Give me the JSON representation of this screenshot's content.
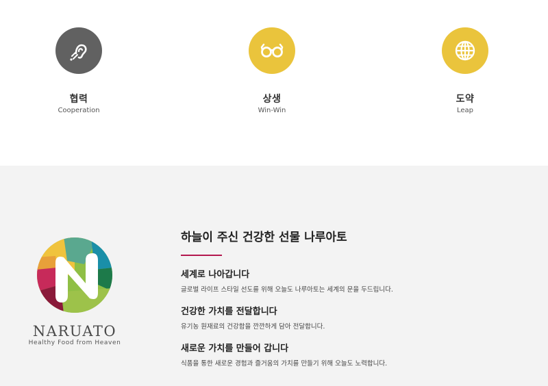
{
  "values": [
    {
      "ko": "협력",
      "en": "Cooperation",
      "icon": "hearing-icon",
      "color": "#616161"
    },
    {
      "ko": "상생",
      "en": "Win-Win",
      "icon": "glasses-icon",
      "color": "#eac43c"
    },
    {
      "ko": "도약",
      "en": "Leap",
      "icon": "globe-icon",
      "color": "#eac43c"
    }
  ],
  "about": {
    "title": "하늘이 주신 건강한 선물 나루아토",
    "accent": "#b3164d",
    "items": [
      {
        "heading": "세계로 나아갑니다",
        "desc": "글로벌 라이프 스타일 선도를 위해 오늘도 나루아토는 세계의 문을 두드립니다."
      },
      {
        "heading": "건강한 가치를 전달합니다",
        "desc": "유기농 원재료의 건강함을 깐깐하게 담아 전달합니다."
      },
      {
        "heading": "새로운 가치를 만들어 갑니다",
        "desc": "식품을 통한 새로운 경험과 즐거움의 가치를 만들기 위해 오늘도 노력합니다."
      }
    ]
  },
  "logo": {
    "brand": "NARUATO",
    "slogan": "Healthy Food from Heaven"
  }
}
